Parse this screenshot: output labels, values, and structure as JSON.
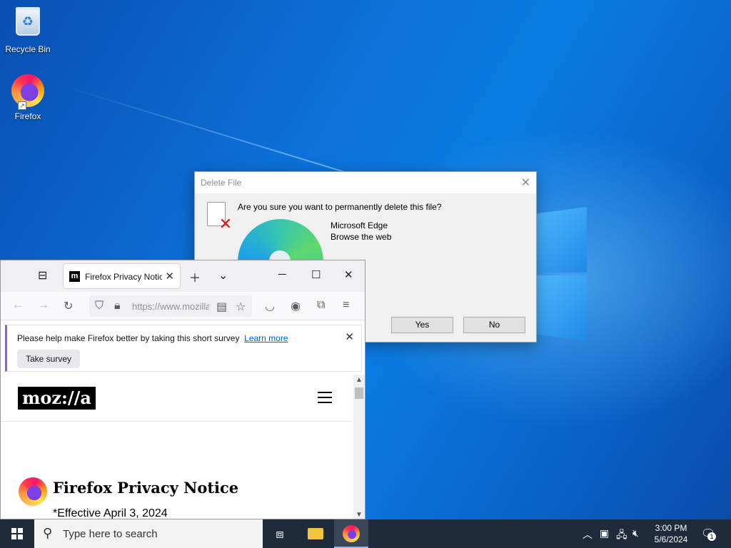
{
  "desktop": {
    "icons": [
      {
        "label": "Recycle Bin",
        "icon": "recycle-bin-icon"
      },
      {
        "label": "Firefox",
        "icon": "firefox-icon"
      }
    ]
  },
  "dialog": {
    "title": "Delete File",
    "question": "Are you sure you want to permanently delete this file?",
    "file_name": "Microsoft Edge",
    "file_desc": "Browse the web",
    "yes_label": "Yes",
    "no_label": "No"
  },
  "firefox": {
    "tab_title": "Firefox Privacy Notice",
    "favicon_text": "m",
    "url": "https://www.mozilla.org/en-US/privacy/firefox/",
    "survey": {
      "message": "Please help make Firefox better by taking this short survey",
      "learn_more": "Learn more",
      "button": "Take survey"
    },
    "page": {
      "logo_text": "moz://a",
      "heading": "Firefox Privacy Notice",
      "effective_date": "*Effective April 3, 2024"
    }
  },
  "taskbar": {
    "search_placeholder": "Type here to search",
    "time": "3:00 PM",
    "date": "5/6/2024",
    "notification_count": "1"
  },
  "colors": {
    "accent": "#0060df",
    "survey_border": "#9059ff",
    "taskbar": "#1f2a3a"
  }
}
